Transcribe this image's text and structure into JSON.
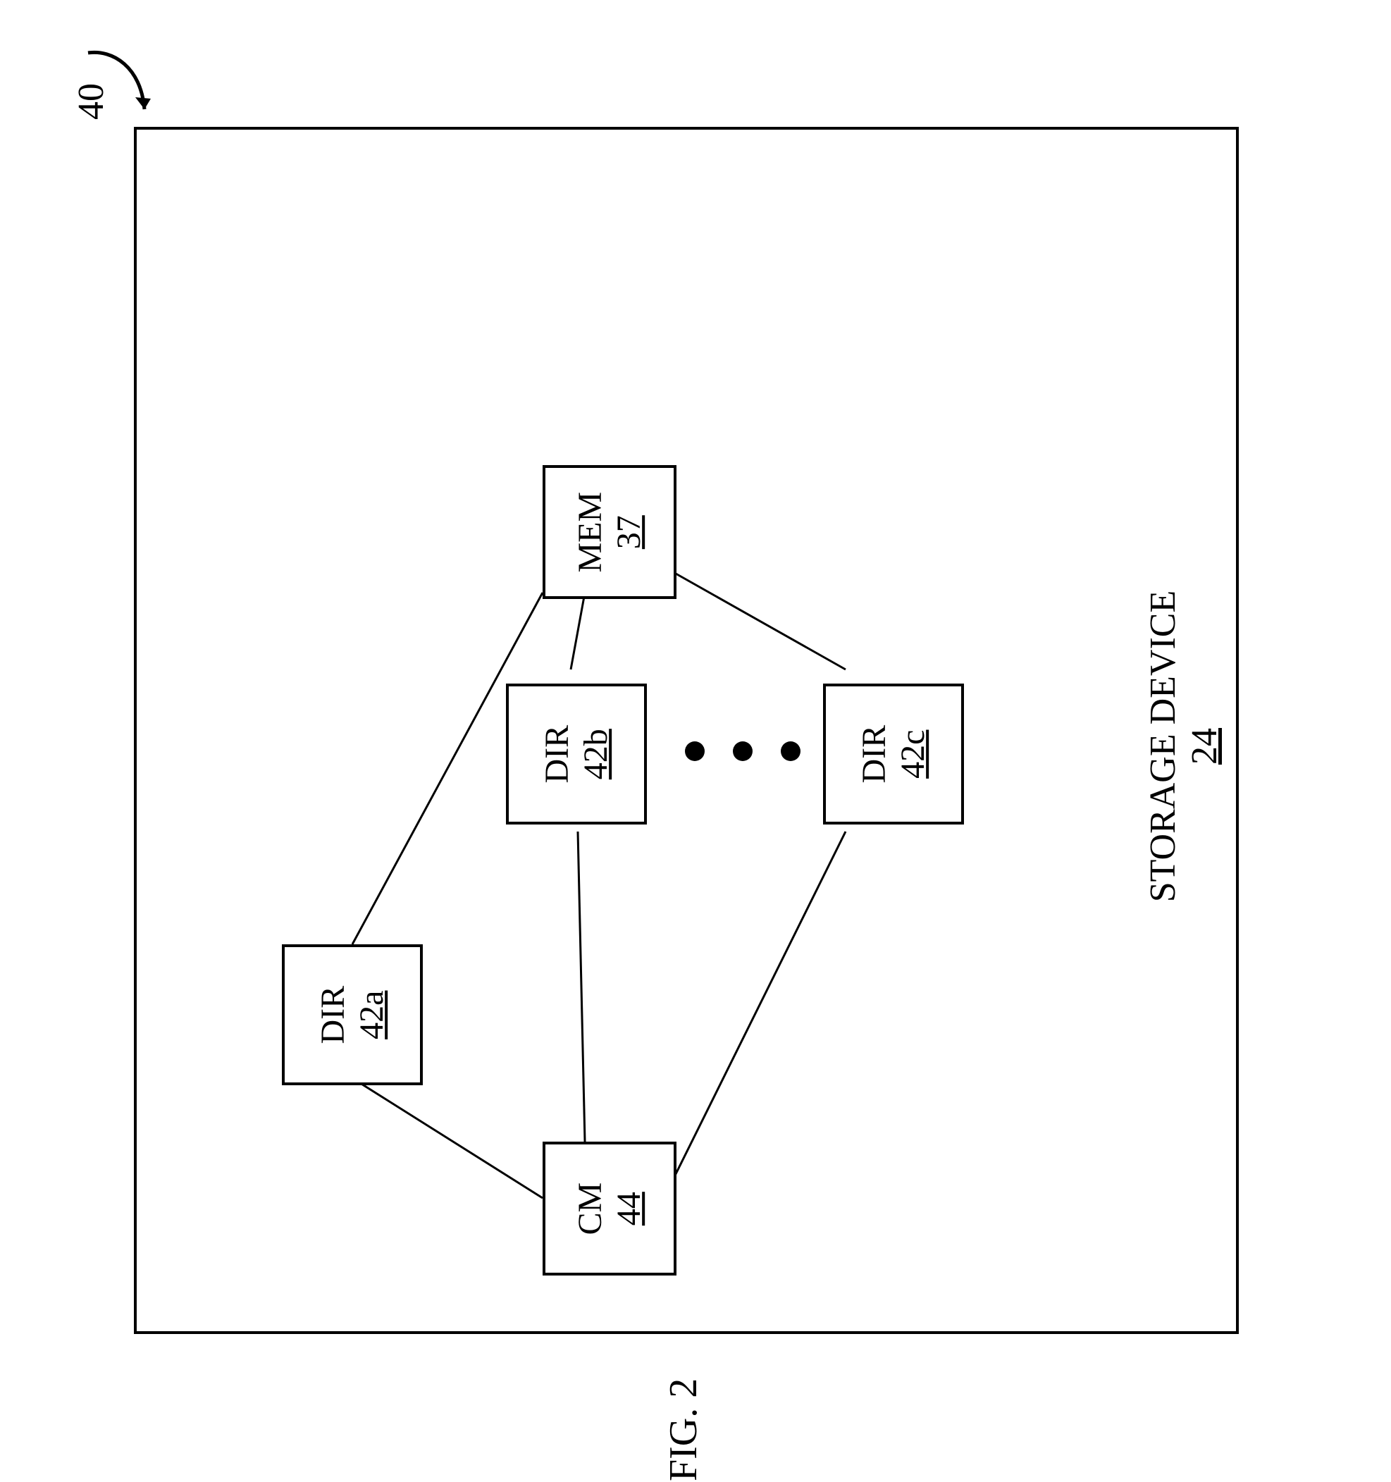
{
  "diagram": {
    "reference_number": "40",
    "figure_caption": "FIG. 2",
    "container": {
      "title": "STORAGE DEVICE",
      "ref": "24"
    },
    "nodes": {
      "mem": {
        "label": "MEM",
        "ref": "37"
      },
      "dir_a": {
        "label": "DIR",
        "ref": "42a"
      },
      "dir_b": {
        "label": "DIR",
        "ref": "42b"
      },
      "dir_c": {
        "label": "DIR",
        "ref": "42c"
      },
      "cm": {
        "label": "CM",
        "ref": "44"
      }
    }
  }
}
